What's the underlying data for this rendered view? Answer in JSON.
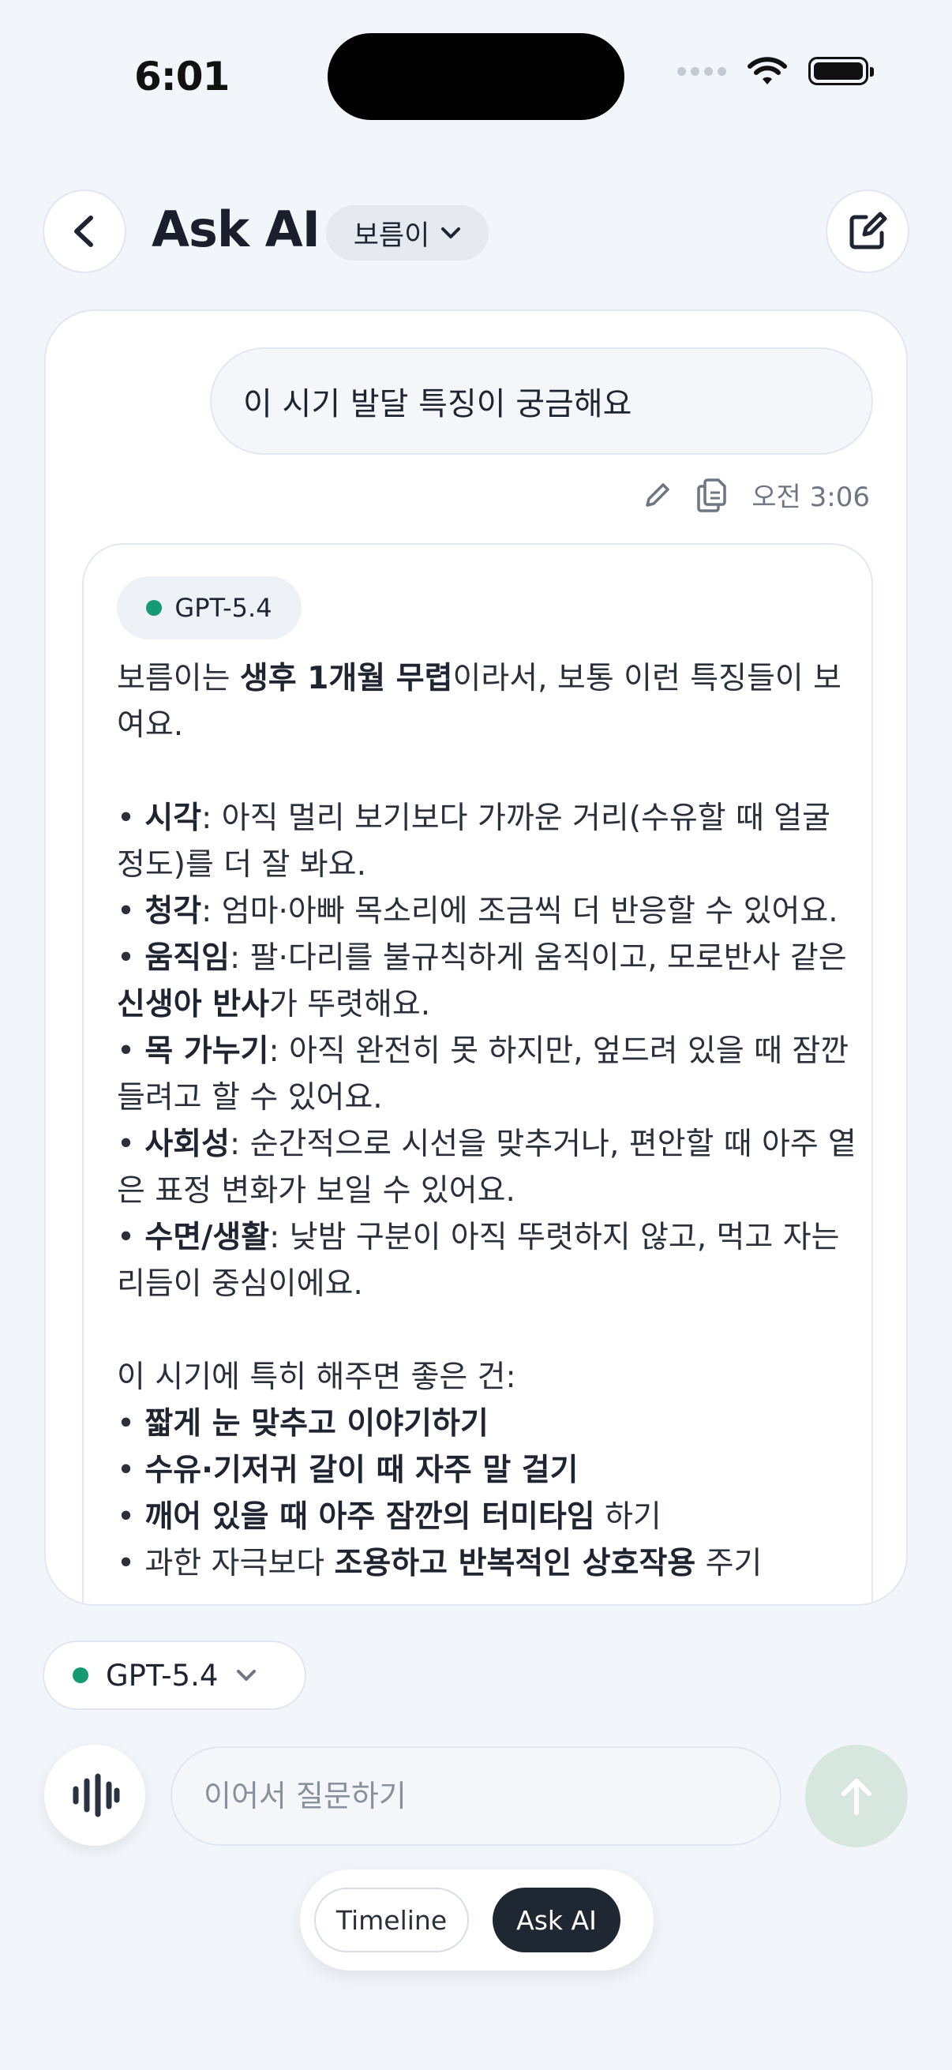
{
  "status_bar": {
    "time": "6:01"
  },
  "header": {
    "title": "Ask AI",
    "child_selector": "보름이"
  },
  "conversation": {
    "user_message": "이 시기 발달 특징이 궁금해요",
    "user_message_time": "오전 3:06",
    "ai_model_badge": "GPT-5.4",
    "ai_intro": {
      "prefix": "보름이는 ",
      "bold": "생후 1개월 무렵",
      "suffix": "이라서, 보통 이런 특징들이 보여요."
    },
    "characteristics": [
      {
        "title": "시각",
        "text": ": 아직 멀리 보기보다 가까운 거리(수유할 때 얼굴 정도)를 더 잘 봐요."
      },
      {
        "title": "청각",
        "text": ": 엄마·아빠 목소리에 조금씩 더 반응할 수 있어요."
      },
      {
        "title": "움직임",
        "text": ": 팔·다리를 불규칙하게 움직이고, 모로반사 같은 ",
        "bold2": "신생아 반사",
        "text2": "가 뚜렷해요."
      },
      {
        "title": "목 가누기",
        "text": ": 아직 완전히 못 하지만, 엎드려 있을 때 잠깐 들려고 할 수 있어요."
      },
      {
        "title": "사회성",
        "text": ": 순간적으로 시선을 맞추거나, 편안할 때 아주 옅은 표정 변화가 보일 수 있어요."
      },
      {
        "title": "수면/생활",
        "text": ": 낮밤 구분이 아직 뚜렷하지 않고, 먹고 자는 리듬이 중심이에요."
      }
    ],
    "tips_heading": "이 시기에 특히 해주면 좋은 건:",
    "tips": [
      {
        "bold": "짧게 눈 맞추고 이야기하기",
        "suffix": ""
      },
      {
        "bold": "수유·기저귀 갈이 때 자주 말 걸기",
        "suffix": ""
      },
      {
        "bold": "깨어 있을 때 아주 잠깐의 터미타임",
        "suffix": " 하기"
      },
      {
        "prefix": "과한 자극보다 ",
        "bold": "조용하고 반복적인 상호작용",
        "suffix": " 주기"
      }
    ]
  },
  "composer": {
    "model": "GPT-5.4",
    "placeholder": "이어서 질문하기"
  },
  "bottom_tabs": {
    "timeline": "Timeline",
    "ask_ai": "Ask AI"
  },
  "colors": {
    "accent_green": "#159a72",
    "send_disabled": "#d7e6de",
    "active_tab": "#1f2733"
  }
}
